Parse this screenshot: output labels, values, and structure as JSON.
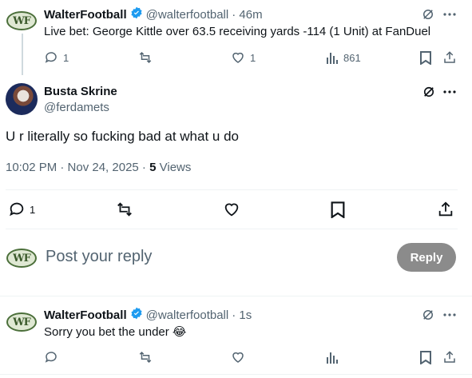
{
  "tweet1": {
    "name": "WalterFootball",
    "handle": "@walterfootball",
    "time": "· 46m",
    "text": "Live bet: George Kittle over 63.5 receiving yards -114 (1 Unit) at FanDuel",
    "replies": "1",
    "likes": "1",
    "views": "861"
  },
  "main": {
    "name": "Busta Skrine",
    "handle": "@ferdamets",
    "text": "U r literally so fucking bad at what u do",
    "timestamp": "10:02 PM · Nov 24, 2025 ·",
    "views_count": "5",
    "views_label": "Views",
    "replies": "1"
  },
  "composer": {
    "avatar_text": "WF",
    "placeholder": "Post your reply",
    "button": "Reply"
  },
  "tweet2": {
    "name": "WalterFootball",
    "handle": "@walterfootball",
    "time": "· 1s",
    "text": "Sorry you bet the under 😂"
  },
  "avatar_text": "WF",
  "colors": {
    "accent": "#1d9bf0",
    "muted": "#536471",
    "button": "#8b8b8b"
  }
}
